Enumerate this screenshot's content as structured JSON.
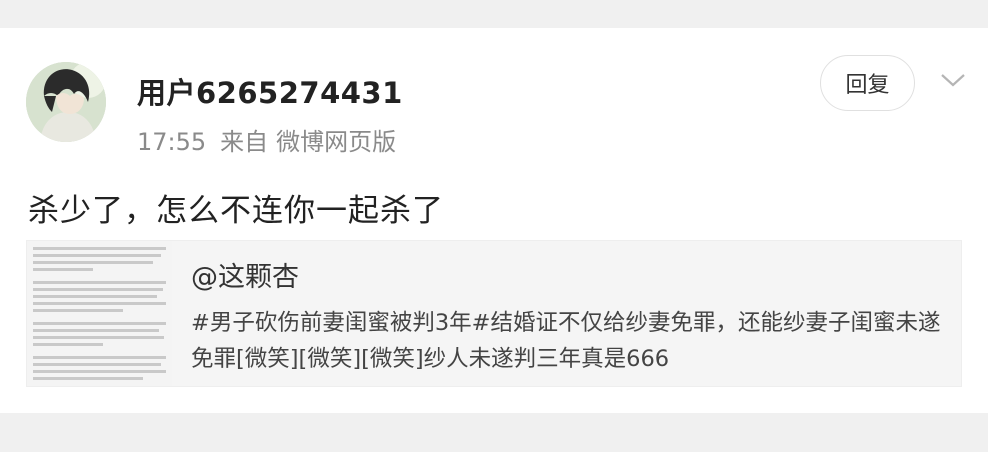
{
  "post": {
    "username": "用户6265274431",
    "time": "17:55",
    "source_prefix": "来自",
    "source": "微博网页版",
    "reply_label": "回复",
    "comment_text": "杀少了，怎么不连你一起杀了"
  },
  "repost": {
    "author": "@这颗杏",
    "text": "#男子砍伤前妻闺蜜被判3年#结婚证不仅给纱妻免罪，还能纱妻子闺蜜未遂免罪[微笑][微笑][微笑]纱人未遂判三年真是666"
  },
  "icons": {
    "avatar": "user-avatar",
    "expand": "chevron-down-icon",
    "thumbnail": "article-thumbnail"
  },
  "colors": {
    "background": "#ffffff",
    "band": "#f0f0f0",
    "repost_bg": "#f5f5f5",
    "muted_text": "#8a8a8a"
  }
}
